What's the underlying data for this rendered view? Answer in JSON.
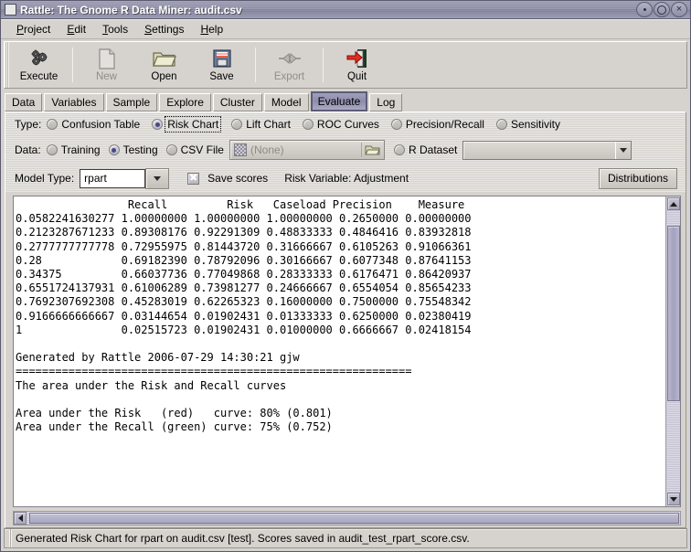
{
  "window": {
    "title": "Rattle: The Gnome R Data Miner: audit.csv",
    "buttons": {
      "minimize": "minimize-button",
      "maximize": "maximize-button",
      "close": "×"
    }
  },
  "menubar": [
    {
      "label": "Project",
      "accel": "P"
    },
    {
      "label": "Edit",
      "accel": "E"
    },
    {
      "label": "Tools",
      "accel": "T"
    },
    {
      "label": "Settings",
      "accel": "S"
    },
    {
      "label": "Help",
      "accel": "H"
    }
  ],
  "toolbar": [
    {
      "label": "Execute",
      "icon": "gears-icon",
      "enabled": true
    },
    {
      "label": "New",
      "icon": "new-document-icon",
      "enabled": false
    },
    {
      "label": "Open",
      "icon": "open-folder-icon",
      "enabled": true
    },
    {
      "label": "Save",
      "icon": "floppy-disk-icon",
      "enabled": true
    },
    {
      "label": "Export",
      "icon": "export-icon",
      "enabled": false
    },
    {
      "label": "Quit",
      "icon": "quit-door-icon",
      "enabled": true
    }
  ],
  "tabs": [
    {
      "label": "Data",
      "active": false
    },
    {
      "label": "Variables",
      "active": false
    },
    {
      "label": "Sample",
      "active": false
    },
    {
      "label": "Explore",
      "active": false
    },
    {
      "label": "Cluster",
      "active": false
    },
    {
      "label": "Model",
      "active": false
    },
    {
      "label": "Evaluate",
      "active": true
    },
    {
      "label": "Log",
      "active": false
    }
  ],
  "type_row": {
    "label": "Type:",
    "options": [
      {
        "label": "Confusion Table",
        "selected": false,
        "focused": false
      },
      {
        "label": "Risk Chart",
        "selected": true,
        "focused": true
      },
      {
        "label": "Lift Chart",
        "selected": false,
        "focused": false
      },
      {
        "label": "ROC Curves",
        "selected": false,
        "focused": false
      },
      {
        "label": "Precision/Recall",
        "selected": false,
        "focused": false
      },
      {
        "label": "Sensitivity",
        "selected": false,
        "focused": false
      }
    ]
  },
  "data_row": {
    "label": "Data:",
    "options": [
      {
        "label": "Training",
        "selected": false
      },
      {
        "label": "Testing",
        "selected": true
      },
      {
        "label": "CSV File",
        "selected": false
      },
      {
        "label": "R Dataset",
        "selected": false
      }
    ],
    "csv_file_value": "(None)",
    "csv_browse_icon": "folder-browse-icon",
    "r_dataset_value": ""
  },
  "model_row": {
    "label": "Model Type:",
    "model_value": "rpart",
    "save_scores": {
      "label": "Save scores",
      "checked": true
    },
    "risk_variable": "Risk Variable: Adjustment",
    "distributions_button": "Distributions"
  },
  "textview": {
    "content": "                 Recall         Risk   Caseload Precision    Measure\n0.0582241630277 1.00000000 1.00000000 1.00000000 0.2650000 0.00000000\n0.2123287671233 0.89308176 0.92291309 0.48833333 0.4846416 0.83932818\n0.2777777777778 0.72955975 0.81443720 0.31666667 0.6105263 0.91066361\n0.28            0.69182390 0.78792096 0.30166667 0.6077348 0.87641153\n0.34375         0.66037736 0.77049868 0.28333333 0.6176471 0.86420937\n0.6551724137931 0.61006289 0.73981277 0.24666667 0.6554054 0.85654233\n0.7692307692308 0.45283019 0.62265323 0.16000000 0.7500000 0.75548342\n0.9166666666667 0.03144654 0.01902431 0.01333333 0.6250000 0.02380419\n1               0.02515723 0.01902431 0.01000000 0.6666667 0.02418154\n\nGenerated by Rattle 2006-07-29 14:30:21 gjw\n============================================================\nThe area under the Risk and Recall curves\n\nArea under the Risk   (red)   curve: 80% (0.801)\nArea under the Recall (green) curve: 75% (0.752)"
  },
  "table_data": {
    "columns": [
      "",
      "Recall",
      "Risk",
      "Caseload",
      "Precision",
      "Measure"
    ],
    "rows": [
      [
        "0.0582241630277",
        "1.00000000",
        "1.00000000",
        "1.00000000",
        "0.2650000",
        "0.00000000"
      ],
      [
        "0.2123287671233",
        "0.89308176",
        "0.92291309",
        "0.48833333",
        "0.4846416",
        "0.83932818"
      ],
      [
        "0.2777777777778",
        "0.72955975",
        "0.81443720",
        "0.31666667",
        "0.6105263",
        "0.91066361"
      ],
      [
        "0.28",
        "0.69182390",
        "0.78792096",
        "0.30166667",
        "0.6077348",
        "0.87641153"
      ],
      [
        "0.34375",
        "0.66037736",
        "0.77049868",
        "0.28333333",
        "0.6176471",
        "0.86420937"
      ],
      [
        "0.6551724137931",
        "0.61006289",
        "0.73981277",
        "0.24666667",
        "0.6554054",
        "0.85654233"
      ],
      [
        "0.7692307692308",
        "0.45283019",
        "0.62265323",
        "0.16000000",
        "0.7500000",
        "0.75548342"
      ],
      [
        "0.9166666666667",
        "0.03144654",
        "0.01902431",
        "0.01333333",
        "0.6250000",
        "0.02380419"
      ],
      [
        "1",
        "0.02515723",
        "0.01902431",
        "0.01000000",
        "0.6666667",
        "0.02418154"
      ]
    ],
    "generated_by": "Generated by Rattle 2006-07-29 14:30:21 gjw",
    "summary_heading": "The area under the Risk and Recall curves",
    "risk_area": "Area under the Risk   (red)   curve: 80% (0.801)",
    "recall_area": "Area under the Recall (green) curve: 75% (0.752)"
  },
  "statusbar": {
    "text": "Generated Risk Chart for rpart on audit.csv [test]. Scores saved in audit_test_rpart_score.csv."
  },
  "colors": {
    "window_bg": "#d6d3ce",
    "titlebar": "#8b8ba4",
    "active_tab": "#8e8eac",
    "radio_accent": "#4a4a78",
    "scrollbar": "#a3a1bd"
  }
}
